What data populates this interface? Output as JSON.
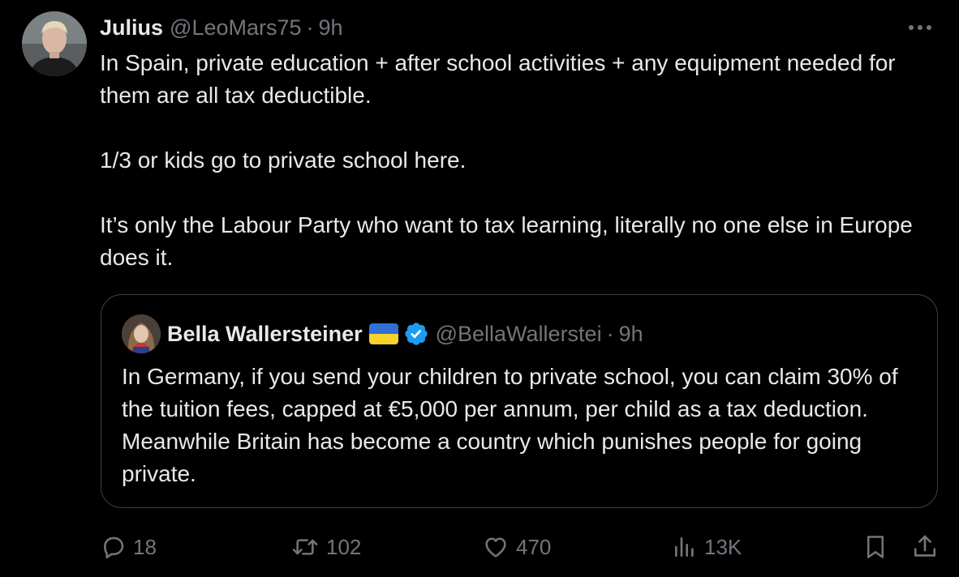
{
  "tweet": {
    "author_name": "Julius",
    "author_handle": "@LeoMars75",
    "separator": "·",
    "time": "9h",
    "paragraphs": [
      "In Spain, private education + after school activities + any equipment needed for them are all tax deductible.",
      "1/3 or kids go to private school here.",
      "It’s only the Labour Party who want to tax learning, literally no one else in Europe does it."
    ]
  },
  "quote": {
    "author_name": "Bella Wallersteiner",
    "author_handle": "@BellaWallerstei",
    "separator": "·",
    "time": "9h",
    "text": "In Germany, if you send your children to private school, you can claim 30% of the tuition fees, capped at €5,000 per annum, per child as a tax deduction. Meanwhile Britain has become a country which punishes people for going private."
  },
  "actions": {
    "replies": "18",
    "reposts": "102",
    "likes": "470",
    "views": "13K"
  },
  "icons": {
    "more": "more-horizontal-icon",
    "reply": "reply-icon",
    "repost": "repost-icon",
    "like": "heart-icon",
    "views": "views-icon",
    "bookmark": "bookmark-icon",
    "share": "share-icon",
    "verified": "verified-badge-icon",
    "flag": "ukraine-flag-icon"
  },
  "colors": {
    "background": "#000000",
    "text": "#e7e9ea",
    "secondary": "#71767b",
    "border": "#3c4044",
    "verified": "#1d9bf0",
    "flag_blue": "#2f6fd6",
    "flag_yellow": "#f7d22b"
  }
}
